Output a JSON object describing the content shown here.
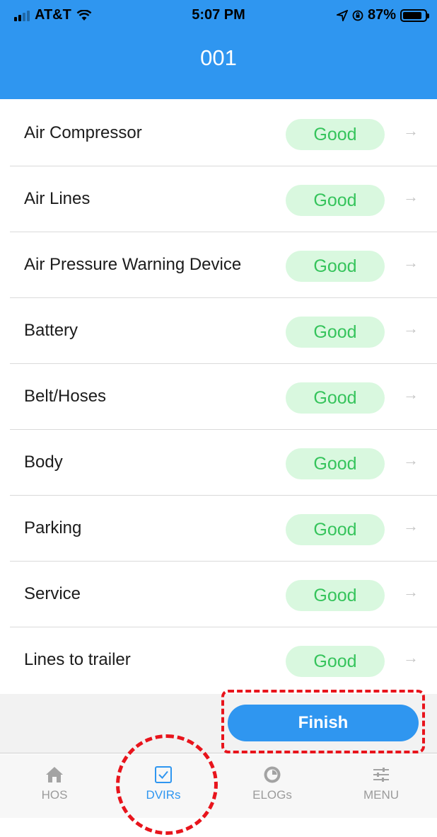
{
  "status_bar": {
    "carrier": "AT&T",
    "time": "5:07 PM",
    "battery_percent": "87%",
    "battery_level": 0.87
  },
  "header": {
    "title": "001"
  },
  "inspection_items": [
    {
      "label": "Air Compressor",
      "status": "Good"
    },
    {
      "label": "Air Lines",
      "status": "Good"
    },
    {
      "label": "Air Pressure Warning Device",
      "status": "Good"
    },
    {
      "label": "Battery",
      "status": "Good"
    },
    {
      "label": "Belt/Hoses",
      "status": "Good"
    },
    {
      "label": "Body",
      "status": "Good"
    },
    {
      "label": "Parking",
      "status": "Good"
    },
    {
      "label": "Service",
      "status": "Good"
    },
    {
      "label": "Lines to trailer",
      "status": "Good"
    }
  ],
  "finish_label": "Finish",
  "tabs": [
    {
      "label": "HOS",
      "icon": "home-icon",
      "active": false
    },
    {
      "label": "DVIRs",
      "icon": "checkbox-icon",
      "active": true
    },
    {
      "label": "ELOGs",
      "icon": "clock-icon",
      "active": false
    },
    {
      "label": "MENU",
      "icon": "sliders-icon",
      "active": false
    }
  ],
  "colors": {
    "accent": "#2f96f0",
    "good_badge_bg": "#d9f8df",
    "good_badge_text": "#36c45c",
    "annotation": "#e8141c"
  }
}
